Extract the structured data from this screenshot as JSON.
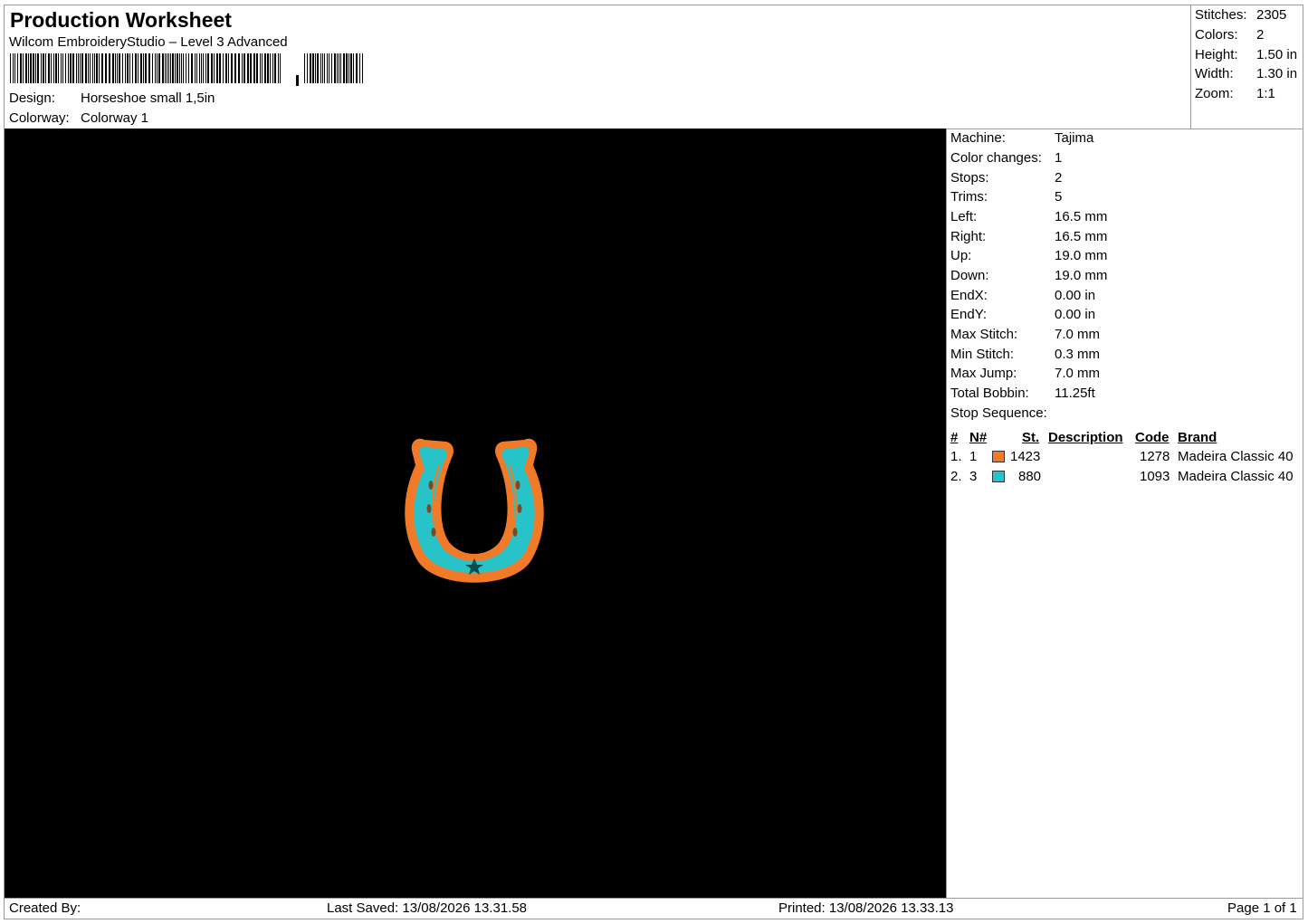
{
  "header": {
    "title": "Production Worksheet",
    "subtitle": "Wilcom EmbroideryStudio – Level 3 Advanced",
    "design_label": "Design:",
    "design_value": "Horseshoe small 1,5in",
    "colorway_label": "Colorway:",
    "colorway_value": "Colorway 1"
  },
  "summary": [
    {
      "label": "Stitches:",
      "value": "2305"
    },
    {
      "label": "Colors:",
      "value": "2"
    },
    {
      "label": "Height:",
      "value": "1.50 in"
    },
    {
      "label": "Width:",
      "value": "1.30 in"
    },
    {
      "label": "Zoom:",
      "value": "1:1"
    }
  ],
  "details": [
    {
      "label": "Machine:",
      "value": "Tajima"
    },
    {
      "label": "Color changes:",
      "value": "1"
    },
    {
      "label": "Stops:",
      "value": "2"
    },
    {
      "label": "Trims:",
      "value": "5"
    },
    {
      "label": "Left:",
      "value": "16.5 mm"
    },
    {
      "label": "Right:",
      "value": "16.5 mm"
    },
    {
      "label": "Up:",
      "value": "19.0 mm"
    },
    {
      "label": "Down:",
      "value": "19.0 mm"
    },
    {
      "label": "EndX:",
      "value": "0.00 in"
    },
    {
      "label": "EndY:",
      "value": "0.00 in"
    },
    {
      "label": "Max Stitch:",
      "value": "7.0 mm"
    },
    {
      "label": "Min Stitch:",
      "value": "0.3 mm"
    },
    {
      "label": "Max Jump:",
      "value": "7.0 mm"
    },
    {
      "label": "Total Bobbin:",
      "value": "11.25ft"
    },
    {
      "label": "Stop Sequence:",
      "value": ""
    }
  ],
  "stop_sequence": {
    "columns": [
      "#",
      "N#",
      "St.",
      "Description",
      "Code",
      "Brand"
    ],
    "rows": [
      {
        "index": "1.",
        "needle": "1",
        "color": "#f07a28",
        "stitches": "1423",
        "description": "",
        "code": "1278",
        "brand": "Madeira Classic 40"
      },
      {
        "index": "2.",
        "needle": "3",
        "color": "#27c3c8",
        "stitches": "880",
        "description": "",
        "code": "1093",
        "brand": "Madeira Classic 40"
      }
    ]
  },
  "footer": {
    "created_by": "Created By:",
    "last_saved": "Last Saved: 13/08/2026 13.31.58",
    "printed": "Printed: 13/08/2026 13.33.13",
    "page": "Page 1 of 1"
  },
  "colors": {
    "thread_orange": "#f07a28",
    "thread_teal": "#27c3c8",
    "canvas_bg": "#000000"
  }
}
